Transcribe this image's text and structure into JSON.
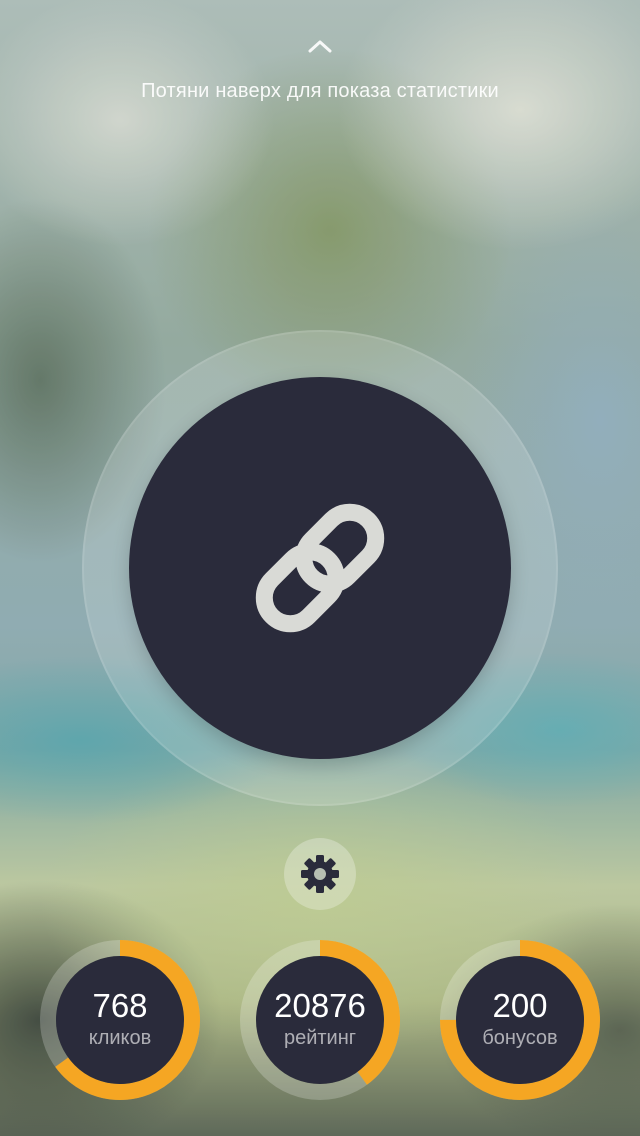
{
  "hint": {
    "text": "Потяни наверх для показа статистики",
    "icon": "chevron-up-icon"
  },
  "main_button": {
    "icon": "link-icon",
    "color": "#2a2b3b"
  },
  "settings": {
    "icon": "gear-icon"
  },
  "stats": [
    {
      "value": "768",
      "label": "кликов",
      "progress": 0.65
    },
    {
      "value": "20876",
      "label": "рейтинг",
      "progress": 0.4
    },
    {
      "value": "200",
      "label": "бонусов",
      "progress": 0.75
    }
  ],
  "colors": {
    "accent": "#f5a623",
    "dark": "#2a2b3b",
    "track": "rgba(255,255,255,0.25)"
  }
}
